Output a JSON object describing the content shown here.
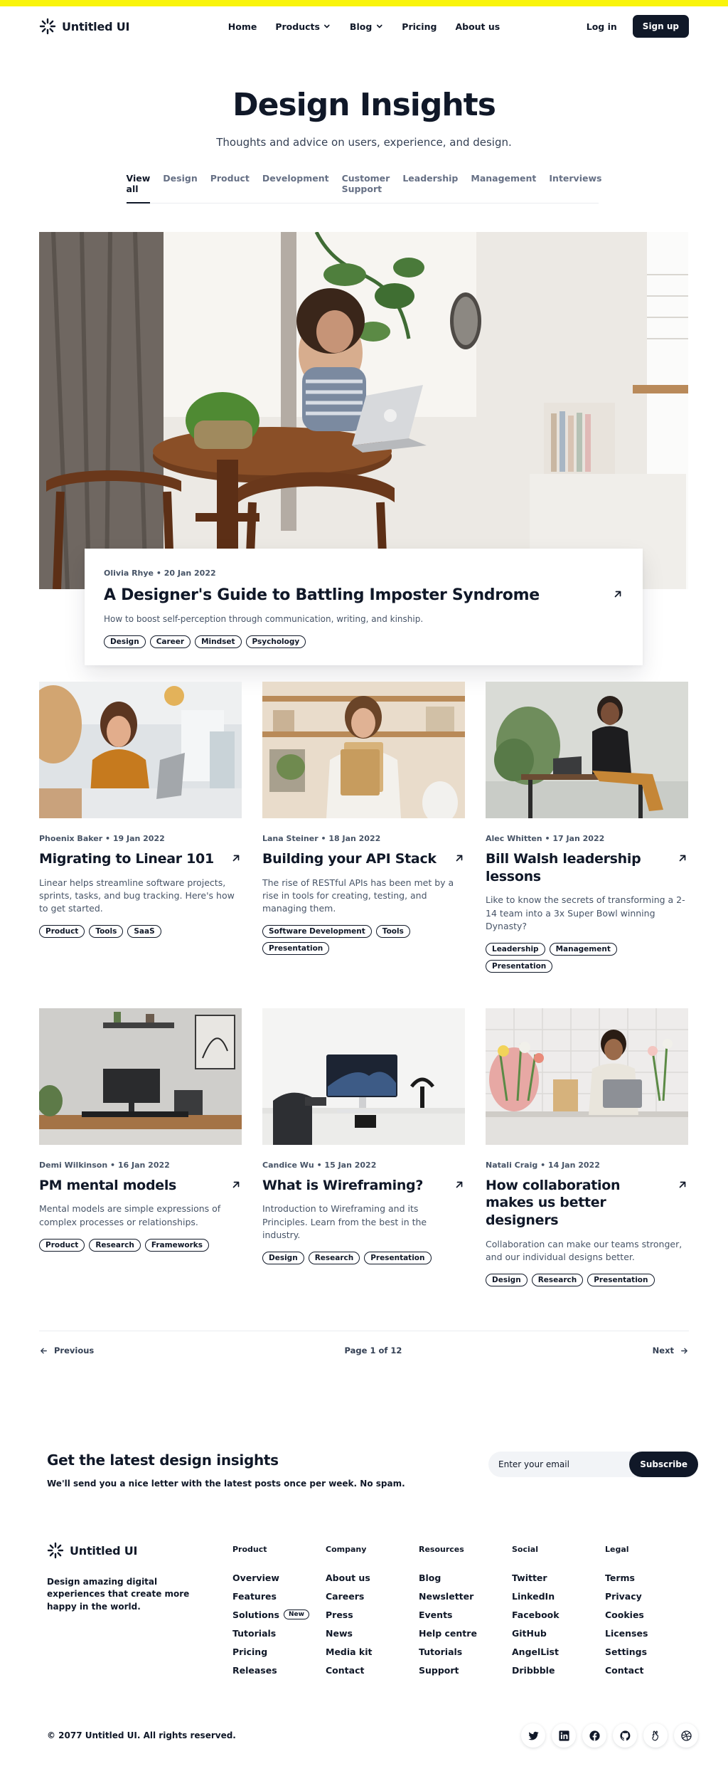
{
  "brand": {
    "name": "Untitled UI"
  },
  "nav": {
    "links": [
      {
        "label": "Home",
        "dropdown": false
      },
      {
        "label": "Products",
        "dropdown": true
      },
      {
        "label": "Blog",
        "dropdown": true
      },
      {
        "label": "Pricing",
        "dropdown": false
      },
      {
        "label": "About us",
        "dropdown": false
      }
    ],
    "login": "Log in",
    "signup": "Sign up"
  },
  "hero": {
    "title": "Design Insights",
    "subtitle": "Thoughts and advice on users, experience, and design."
  },
  "tabs": [
    "View all",
    "Design",
    "Product",
    "Development",
    "Customer Support",
    "Leadership",
    "Management",
    "Interviews"
  ],
  "active_tab": "View all",
  "featured": {
    "meta": "Olivia Rhye • 20 Jan 2022",
    "title": "A Designer's Guide to Battling Imposter Syndrome",
    "description": "How to boost self-perception through communication, writing, and kinship.",
    "tags": [
      "Design",
      "Career",
      "Mindset",
      "Psychology"
    ]
  },
  "posts": [
    {
      "meta": "Phoenix Baker • 19 Jan 2022",
      "title": "Migrating to Linear 101",
      "description": "Linear helps streamline software projects, sprints, tasks, and bug tracking. Here's how to get started.",
      "tags": [
        "Product",
        "Tools",
        "SaaS"
      ]
    },
    {
      "meta": "Lana Steiner • 18 Jan 2022",
      "title": "Building your API Stack",
      "description": "The rise of RESTful APIs has been met by a rise in tools for creating, testing, and managing them.",
      "tags": [
        "Software Development",
        "Tools",
        "Presentation"
      ]
    },
    {
      "meta": "Alec Whitten • 17 Jan 2022",
      "title": "Bill Walsh leadership lessons",
      "description": "Like to know the secrets of transforming a 2-14 team into a 3x Super Bowl winning Dynasty?",
      "tags": [
        "Leadership",
        "Management",
        "Presentation"
      ]
    },
    {
      "meta": "Demi Wilkinson • 16 Jan 2022",
      "title": "PM mental models",
      "description": "Mental models are simple expressions of complex processes or relationships.",
      "tags": [
        "Product",
        "Research",
        "Frameworks"
      ]
    },
    {
      "meta": "Candice Wu • 15 Jan 2022",
      "title": "What is Wireframing?",
      "description": "Introduction to Wireframing and its Principles. Learn from the best in the industry.",
      "tags": [
        "Design",
        "Research",
        "Presentation"
      ]
    },
    {
      "meta": "Natali Craig • 14 Jan 2022",
      "title": "How collaboration makes us better designers",
      "description": "Collaboration can make our teams stronger, and our individual designs better.",
      "tags": [
        "Design",
        "Research",
        "Presentation"
      ]
    }
  ],
  "pagination": {
    "previous": "Previous",
    "page_label": "Page 1  of 12",
    "next": "Next"
  },
  "newsletter": {
    "title": "Get the latest design insights",
    "subtitle": "We'll send you a nice letter with the latest posts once per week. No spam.",
    "placeholder": "Enter your email",
    "button": "Subscribe"
  },
  "footer": {
    "tagline": "Design amazing digital experiences that create more happy in the world.",
    "columns": [
      {
        "heading": "Product",
        "items": [
          {
            "label": "Overview"
          },
          {
            "label": "Features"
          },
          {
            "label": "Solutions",
            "badge": "New"
          },
          {
            "label": "Tutorials"
          },
          {
            "label": "Pricing"
          },
          {
            "label": "Releases"
          }
        ]
      },
      {
        "heading": "Company",
        "items": [
          {
            "label": "About us"
          },
          {
            "label": "Careers"
          },
          {
            "label": "Press"
          },
          {
            "label": "News"
          },
          {
            "label": "Media kit"
          },
          {
            "label": "Contact"
          }
        ]
      },
      {
        "heading": "Resources",
        "items": [
          {
            "label": "Blog"
          },
          {
            "label": "Newsletter"
          },
          {
            "label": "Events"
          },
          {
            "label": "Help centre"
          },
          {
            "label": "Tutorials"
          },
          {
            "label": "Support"
          }
        ]
      },
      {
        "heading": "Social",
        "items": [
          {
            "label": "Twitter"
          },
          {
            "label": "LinkedIn"
          },
          {
            "label": "Facebook"
          },
          {
            "label": "GitHub"
          },
          {
            "label": "AngelList"
          },
          {
            "label": "Dribbble"
          }
        ]
      },
      {
        "heading": "Legal",
        "items": [
          {
            "label": "Terms"
          },
          {
            "label": "Privacy"
          },
          {
            "label": "Cookies"
          },
          {
            "label": "Licenses"
          },
          {
            "label": "Settings"
          },
          {
            "label": "Contact"
          }
        ]
      }
    ],
    "copyright": "© 2077 Untitled UI. All rights reserved.",
    "social_icons": [
      "twitter-icon",
      "linkedin-icon",
      "facebook-icon",
      "github-icon",
      "angellist-icon",
      "dribbble-icon"
    ]
  },
  "colors": {
    "accent_bar": "#f9f40b",
    "primary": "#101828",
    "muted": "#475467"
  }
}
